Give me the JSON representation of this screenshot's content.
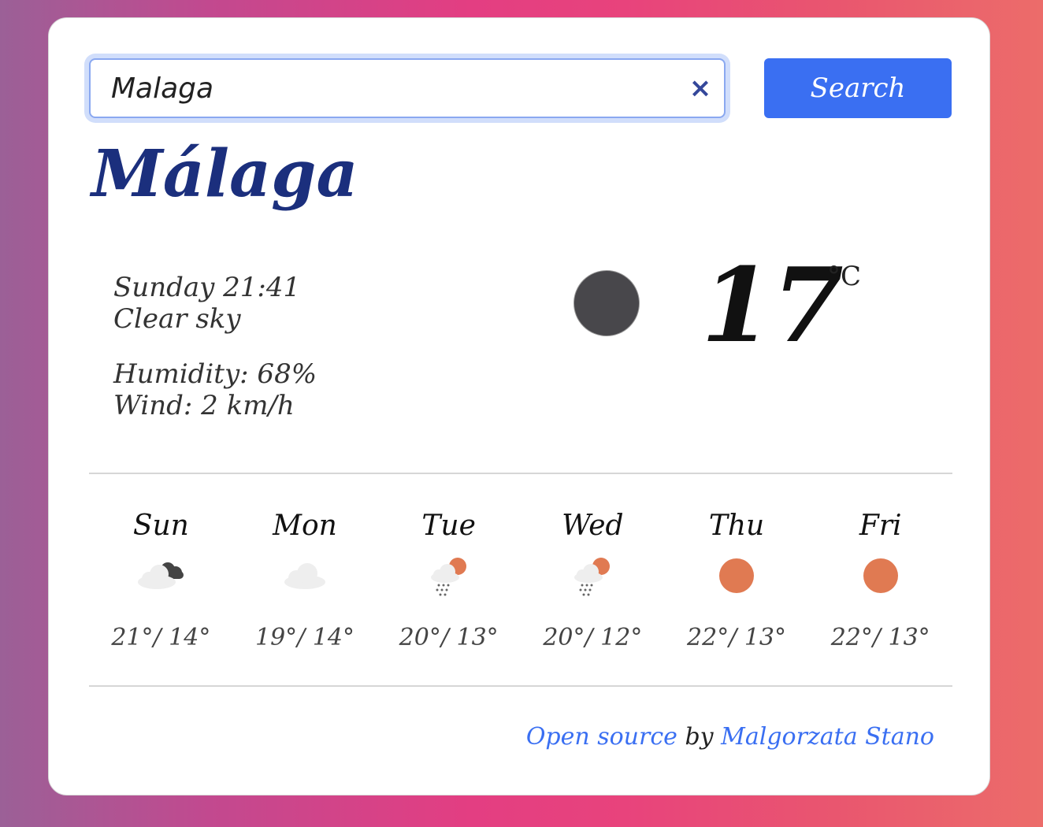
{
  "search": {
    "value": "Malaga",
    "button_label": "Search"
  },
  "current": {
    "city": "Málaga",
    "datetime": "Sunday 21:41",
    "description": "Clear sky",
    "humidity": "Humidity: 68%",
    "wind": "Wind: 2 km/h",
    "temperature": "17",
    "unit": "°C",
    "icon": "night-clear-icon",
    "icon_color": "#48474b"
  },
  "forecast": [
    {
      "day": "Sun",
      "icon": "cloudy-night-icon",
      "temps": "21°/ 14°"
    },
    {
      "day": "Mon",
      "icon": "cloud-icon",
      "temps": "19°/ 14°"
    },
    {
      "day": "Tue",
      "icon": "rain-sun-icon",
      "temps": "20°/ 13°"
    },
    {
      "day": "Wed",
      "icon": "rain-sun-icon",
      "temps": "20°/ 12°"
    },
    {
      "day": "Thu",
      "icon": "sun-icon",
      "temps": "22°/ 13°"
    },
    {
      "day": "Fri",
      "icon": "sun-icon",
      "temps": "22°/ 13°"
    }
  ],
  "footer": {
    "link1": "Open source",
    "by": " by ",
    "link2": "Malgorzata Stano"
  },
  "colors": {
    "accent": "#3a6ff2",
    "title": "#1b2f7d",
    "sun": "#e07a52"
  }
}
